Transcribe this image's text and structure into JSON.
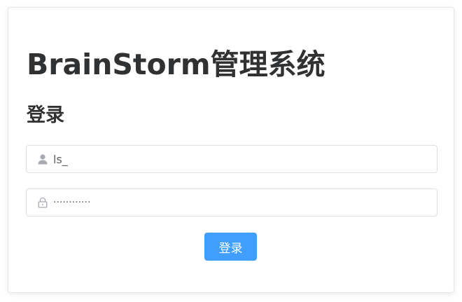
{
  "login": {
    "app_title": "BrainStorm管理系统",
    "heading": "登录",
    "username": {
      "value": "ls_",
      "icon": "user-icon"
    },
    "password": {
      "value": "············",
      "icon": "lock-icon"
    },
    "submit_label": "登录"
  },
  "colors": {
    "primary": "#409eff",
    "text": "#303133",
    "border": "#dcdfe6",
    "icon": "#a8abb2"
  }
}
